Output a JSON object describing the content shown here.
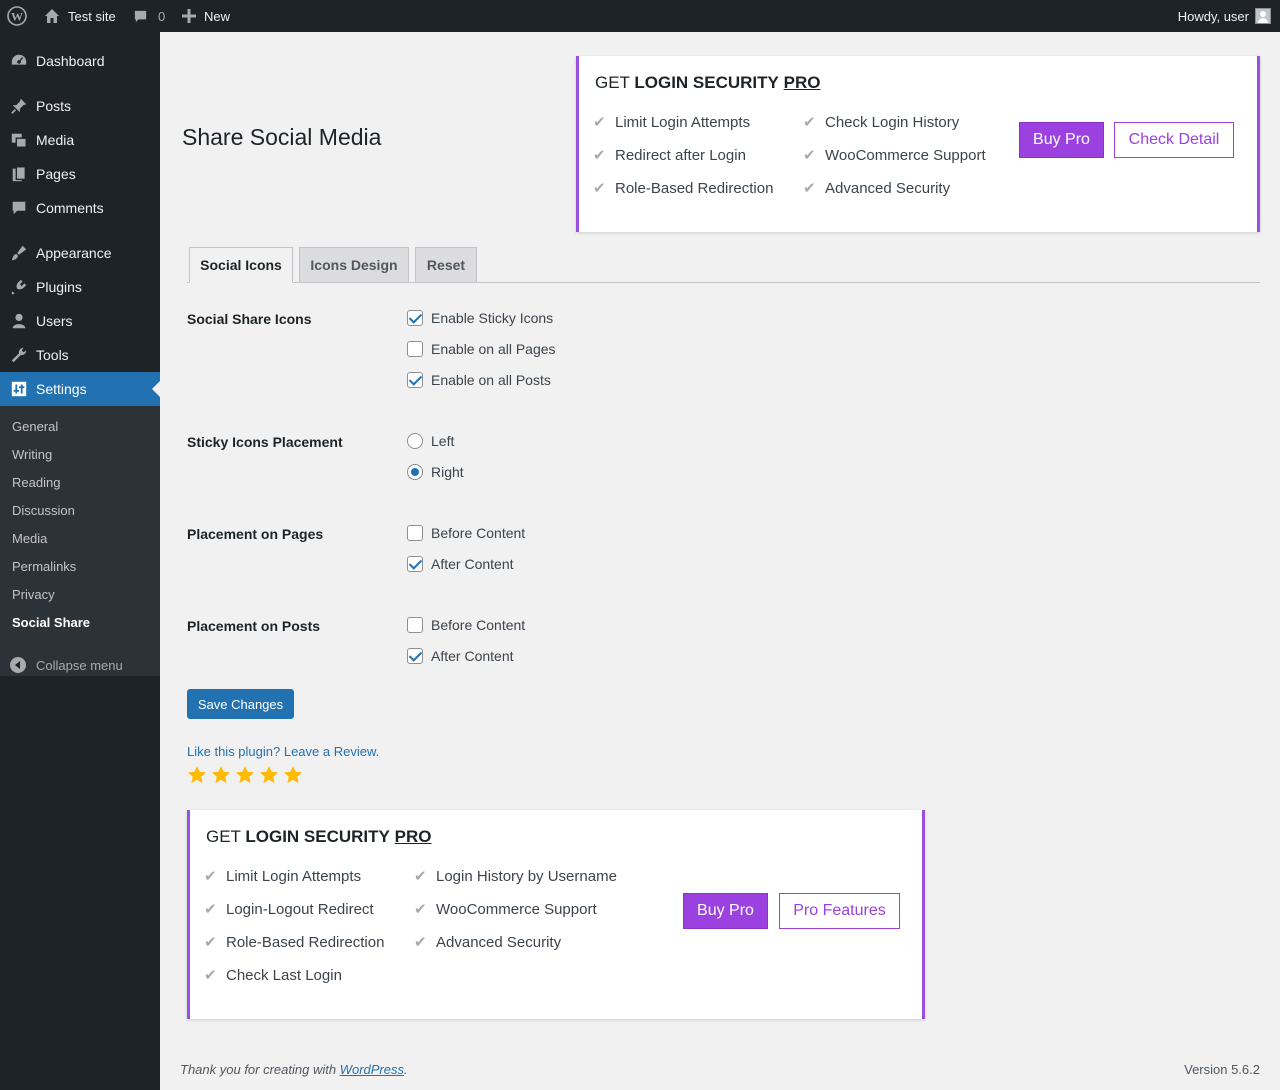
{
  "admin_bar": {
    "site_name": "Test site",
    "comments_count": "0",
    "new_label": "New",
    "howdy": "Howdy, user"
  },
  "sidebar": {
    "items": [
      {
        "label": "Dashboard",
        "icon": "dashboard-icon"
      },
      {
        "label": "Posts",
        "icon": "pin-icon"
      },
      {
        "label": "Media",
        "icon": "media-icon"
      },
      {
        "label": "Pages",
        "icon": "pages-icon"
      },
      {
        "label": "Comments",
        "icon": "comment-icon"
      },
      {
        "label": "Appearance",
        "icon": "brush-icon"
      },
      {
        "label": "Plugins",
        "icon": "plug-icon"
      },
      {
        "label": "Users",
        "icon": "user-icon"
      },
      {
        "label": "Tools",
        "icon": "wrench-icon"
      },
      {
        "label": "Settings",
        "icon": "settings-icon"
      }
    ],
    "submenu": [
      "General",
      "Writing",
      "Reading",
      "Discussion",
      "Media",
      "Permalinks",
      "Privacy",
      "Social Share"
    ],
    "collapse": "Collapse menu"
  },
  "page": {
    "title": "Share Social Media"
  },
  "promo_top": {
    "get": "GET",
    "product": "LOGIN SECURITY",
    "pro": "PRO",
    "features_col1": [
      "Limit Login Attempts",
      "Redirect after Login",
      "Role-Based Redirection"
    ],
    "features_col2": [
      "Check Login History",
      "WooCommerce Support",
      "Advanced Security"
    ],
    "buy_label": "Buy Pro",
    "detail_label": "Check Detail"
  },
  "tabs": [
    "Social Icons",
    "Icons Design",
    "Reset"
  ],
  "form": {
    "share_icons": {
      "label": "Social Share Icons",
      "options": [
        {
          "label": "Enable Sticky Icons",
          "checked": true
        },
        {
          "label": "Enable on all Pages",
          "checked": false
        },
        {
          "label": "Enable on all Posts",
          "checked": true
        }
      ]
    },
    "placement": {
      "label": "Sticky Icons Placement",
      "options": [
        {
          "label": "Left",
          "checked": false
        },
        {
          "label": "Right",
          "checked": true
        }
      ]
    },
    "pages": {
      "label": "Placement on Pages",
      "options": [
        {
          "label": "Before Content",
          "checked": false
        },
        {
          "label": "After Content",
          "checked": true
        }
      ]
    },
    "posts": {
      "label": "Placement on Posts",
      "options": [
        {
          "label": "Before Content",
          "checked": false
        },
        {
          "label": "After Content",
          "checked": true
        }
      ]
    },
    "save_label": "Save Changes"
  },
  "review": {
    "text": "Like this plugin? Leave a Review.",
    "stars": 5,
    "star_color": "#ffb900"
  },
  "promo_bottom": {
    "get": "GET",
    "product": "LOGIN SECURITY",
    "pro": "PRO",
    "features_col1": [
      "Limit Login Attempts",
      "Login-Logout Redirect",
      "Role-Based Redirection",
      "Check Last Login"
    ],
    "features_col2": [
      "Login History by Username",
      "WooCommerce Support",
      "Advanced Security"
    ],
    "buy_label": "Buy Pro",
    "features_label": "Pro Features"
  },
  "footer": {
    "thanks_prefix": "Thank you for creating with",
    "link": "WordPress",
    "suffix": ".",
    "version": "Version 5.6.2"
  },
  "colors": {
    "accent": "#9b41e0",
    "wp_blue": "#2271b1",
    "sidebar_bg": "#1d2327"
  }
}
